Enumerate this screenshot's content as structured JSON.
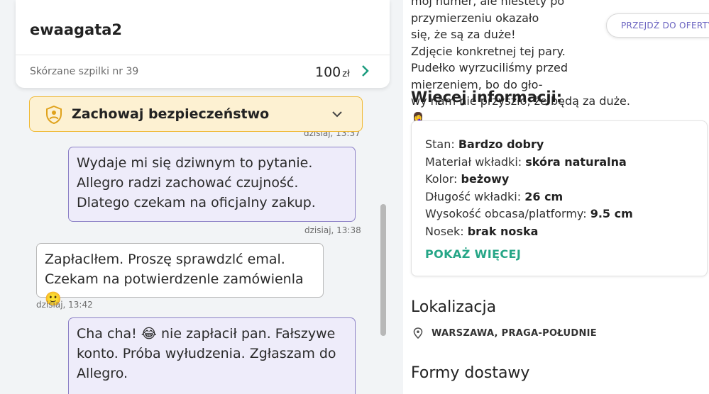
{
  "chat": {
    "username": "ewaagata2",
    "offer": {
      "title": "Skórzane szpilki nr 39",
      "price": "100",
      "currency": "zł"
    },
    "safety_banner": "Zachowaj bezpieczeństwo",
    "messages": [
      {
        "type": "out",
        "timestamp_above": "dzisiaj, 13:37",
        "text": "Wydaje mi się dziwnym to pytanie. Allegro radzi zachować czujność. Dlatego czekam na oficjalny zakup.",
        "timestamp": "dzisiaj, 13:38"
      },
      {
        "type": "in",
        "text": "Zapłaclłem. Proszę sprawdzlć emal. Czekam na potwierdzenle zamówienla🙂",
        "timestamp": "dzisiaj, 13:42"
      },
      {
        "type": "out",
        "text": "Cha cha! 😂 nie zapłacił pan. Fałszywe konto. Próba wyłudzenia. Zgłaszam do Allegro."
      }
    ]
  },
  "listing": {
    "description_lines": [
      "mój numer, ale niestety po przymierzeniu okazało",
      "się, że są za duże!",
      "Zdjęcie konkretnej tej pary.",
      "Pudełko wyrzuciliśmy przed mierzeniem, bo do gło-",
      "wy nam nie przyszło, że będą za duże. 🤦‍♀️"
    ],
    "cta_button": "PRZEJDŹ DO OFERTY",
    "more_info_title": "Więcej informacji:",
    "details": [
      {
        "label": "Stan:",
        "value": "Bardzo dobry"
      },
      {
        "label": "Materiał wkładki:",
        "value": "skóra naturalna"
      },
      {
        "label": "Kolor:",
        "value": "beżowy"
      },
      {
        "label": "Długość wkładki:",
        "value": "26 cm"
      },
      {
        "label": "Wysokość obcasa/platformy:",
        "value": "9.5 cm"
      },
      {
        "label": "Nosek:",
        "value": "brak noska"
      }
    ],
    "show_more": "POKAŻ WIĘCEJ",
    "location_title": "Lokalizacja",
    "location": "WARSZAWA, PRAGA-POŁUDNIE",
    "delivery_title": "Formy dostawy"
  },
  "icons": {
    "shield": "shield-person-icon",
    "banner_chevron": "chevron-down-icon",
    "offer_chevron": "chevron-right-icon",
    "location": "map-pin-icon"
  },
  "colors": {
    "accent_green": "#1b9c7e",
    "banner_bg": "#fdf1d2",
    "banner_border": "#f0b933",
    "bubble_out_bg": "#eeecfa",
    "bubble_out_border": "#8c80c6",
    "cta_text": "#6a63c0"
  }
}
